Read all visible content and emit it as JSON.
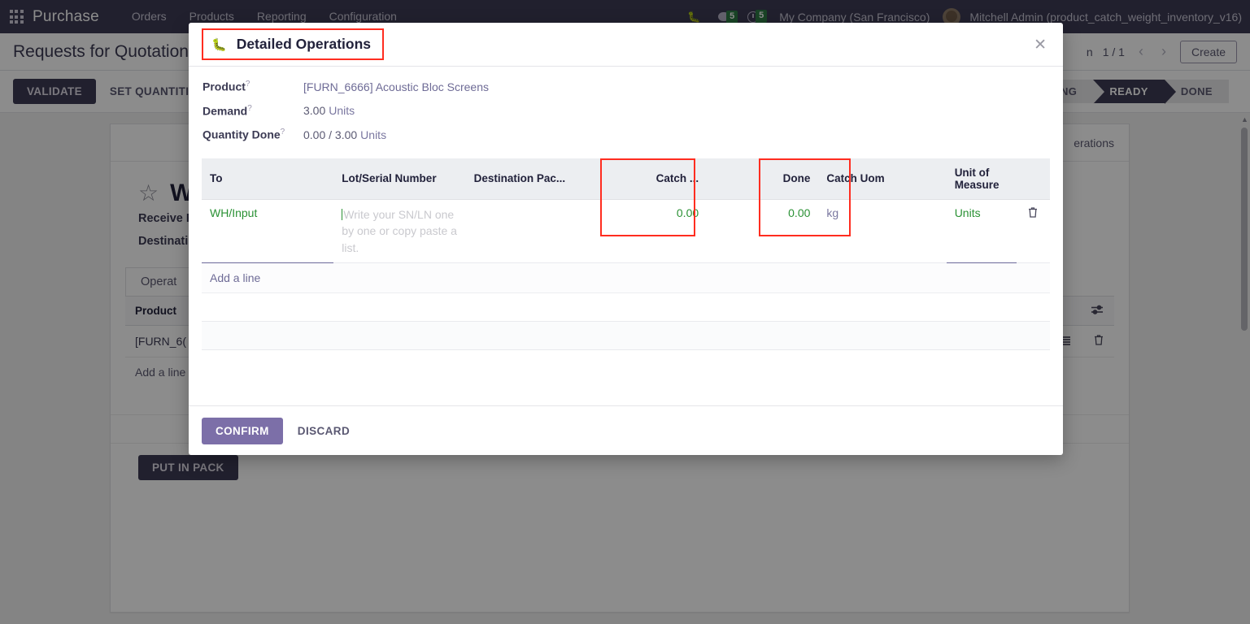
{
  "navbar": {
    "apps_icon": "apps-grid-icon",
    "brand": "Purchase",
    "menus": [
      "Orders",
      "Products",
      "Reporting",
      "Configuration"
    ],
    "debug_icon": "bug-icon",
    "messages_badge": "5",
    "activities_badge": "5",
    "company": "My Company (San Francisco)",
    "user": "Mitchell Admin (product_catch_weight_inventory_v16)"
  },
  "control_panel": {
    "breadcrumb": "Requests for Quotation",
    "breadcrumb_tail": "n",
    "pager": "1 / 1",
    "prev_icon": "chevron-left-icon",
    "next_icon": "chevron-right-icon",
    "create_label": "Create"
  },
  "action_bar": {
    "validate": "VALIDATE",
    "set_quantities": "SET QUANTITIES",
    "statuses": [
      "WAITING",
      "READY",
      "DONE"
    ],
    "active_status": "READY"
  },
  "record": {
    "smart_button": "erations",
    "star_icon": "star-icon",
    "title": "W",
    "field_receive": "Receive F",
    "field_destination": "Destinati",
    "tab": "Operat",
    "table_header": "Product",
    "row_product": "[FURN_6(",
    "add_a_line": "Add a line",
    "put_in_pack": "PUT IN PACK",
    "settings_icon": "sliders-icon",
    "list_icon": "list-icon",
    "trash_icon": "trash-icon"
  },
  "modal": {
    "icon": "bug-icon",
    "title": "Detailed Operations",
    "close_icon": "close-icon",
    "fields": [
      {
        "label": "Product",
        "help": "?",
        "value": "[FURN_6666] Acoustic Bloc Screens",
        "suffix": ""
      },
      {
        "label": "Demand",
        "help": "?",
        "value": "3.00",
        "suffix": "Units"
      },
      {
        "label": "Quantity Done",
        "help": "?",
        "value": "0.00 / 3.00",
        "suffix": "Units"
      }
    ],
    "table": {
      "columns": [
        "To",
        "Lot/Serial Number",
        "Destination Pac...",
        "Catch ...",
        "Done",
        "Catch Uom",
        "Unit of Measure",
        ""
      ],
      "rows": [
        {
          "to": "WH/Input",
          "lot_placeholder": "Write your SN/LN one by one or copy paste a list.",
          "destination_package": "",
          "catch_weight": "0.00",
          "done": "0.00",
          "catch_uom": "kg",
          "unit_of_measure": "Units",
          "delete_icon": "trash-icon"
        }
      ],
      "add_a_line": "Add a line"
    },
    "confirm_label": "CONFIRM",
    "discard_label": "DISCARD"
  },
  "colors": {
    "brand_purple": "#3c3b54",
    "accent_purple": "#7c6fa8",
    "highlight_red": "#ff2d20",
    "value_green": "#2a9134",
    "badge_green": "#2e7d46"
  }
}
